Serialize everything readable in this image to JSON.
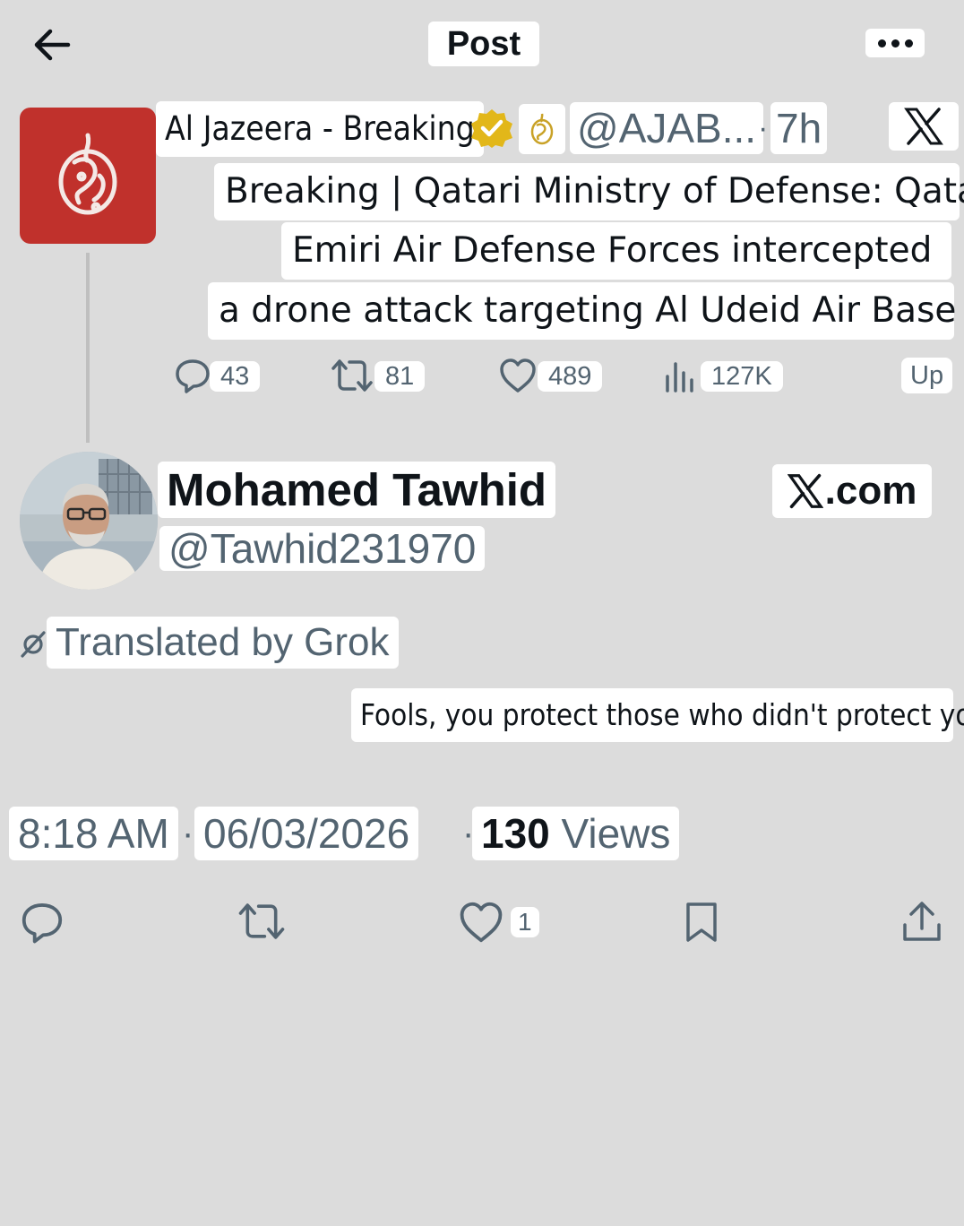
{
  "header": {
    "title": "Post"
  },
  "quoted_post": {
    "author_name": "Al Jazeera - Breaking",
    "handle": "@AJAB...",
    "separator": "·",
    "time": "7h",
    "text_lines": [
      "Breaking | Qatari Ministry of Defense: Qatari",
      "Emiri Air Defense Forces intercepted",
      "a drone attack targeting Al Udeid Air Base"
    ],
    "metrics": {
      "replies": "43",
      "reposts": "81",
      "likes": "489",
      "views": "127K",
      "up_label": "Up"
    }
  },
  "post": {
    "author_name": "Mohamed Tawhid",
    "handle": "@Tawhid231970",
    "source_label": ".com",
    "translated_label": "Translated by Grok",
    "text": "Fools, you protect those who didn't protect you",
    "time": "8:18 AM",
    "separator": "·",
    "date": "06/03/2026",
    "views_count": "130",
    "views_label": "Views",
    "like_count": "1"
  },
  "colors": {
    "background": "#dcdcdc",
    "text_primary": "#0f1419",
    "text_secondary": "#536471",
    "aljazeera_red": "#c0312c",
    "verified_gold": "#e2b719"
  },
  "icons": [
    "back-arrow-icon",
    "more-icon",
    "verified-badge-icon",
    "x-logo-icon",
    "reply-icon",
    "repost-icon",
    "like-icon",
    "views-icon",
    "grok-icon",
    "bookmark-icon",
    "share-icon"
  ]
}
